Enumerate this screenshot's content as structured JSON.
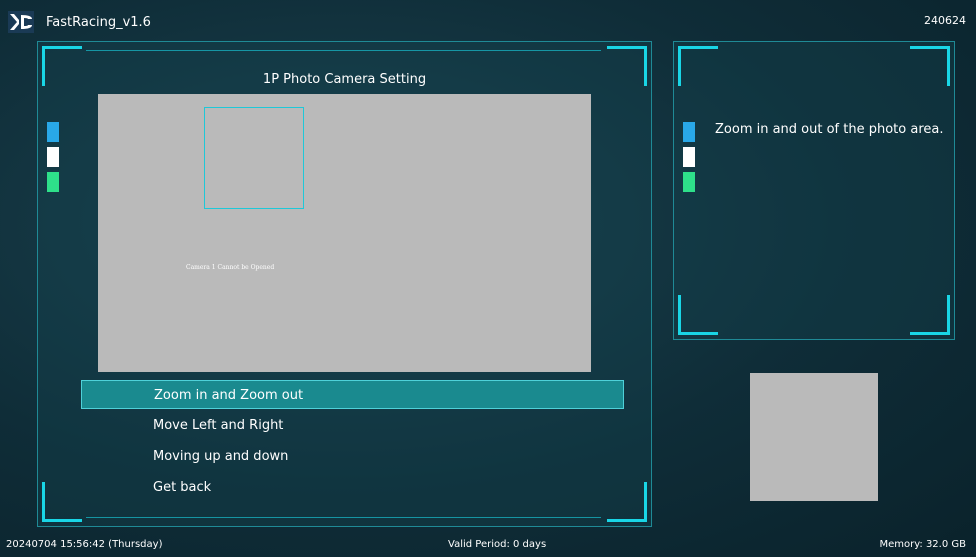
{
  "app": {
    "title": "FastRacing_v1.6",
    "build": "240624"
  },
  "main_panel": {
    "title": "1P Photo Camera Setting",
    "camera_message": "Camera 1 Cannot be Opened"
  },
  "menu": {
    "items": [
      {
        "label": "Zoom in and Zoom out",
        "selected": true
      },
      {
        "label": "Move Left and Right",
        "selected": false
      },
      {
        "label": "Moving up and down",
        "selected": false
      },
      {
        "label": "Get back",
        "selected": false
      }
    ]
  },
  "info_panel": {
    "text": "Zoom in and out of the photo area."
  },
  "status_bar": {
    "datetime": "20240704 15:56:42 (Thursday)",
    "valid_period": "Valid Period: 0 days",
    "memory": "Memory: 32.0 GB"
  },
  "colors": {
    "accent": "#19d6e6",
    "selected_bg": "#1a8a8f",
    "tab_blue": "#29a8e8",
    "tab_white": "#ffffff",
    "tab_green": "#2ee08a",
    "preview_gray": "#bababa"
  }
}
